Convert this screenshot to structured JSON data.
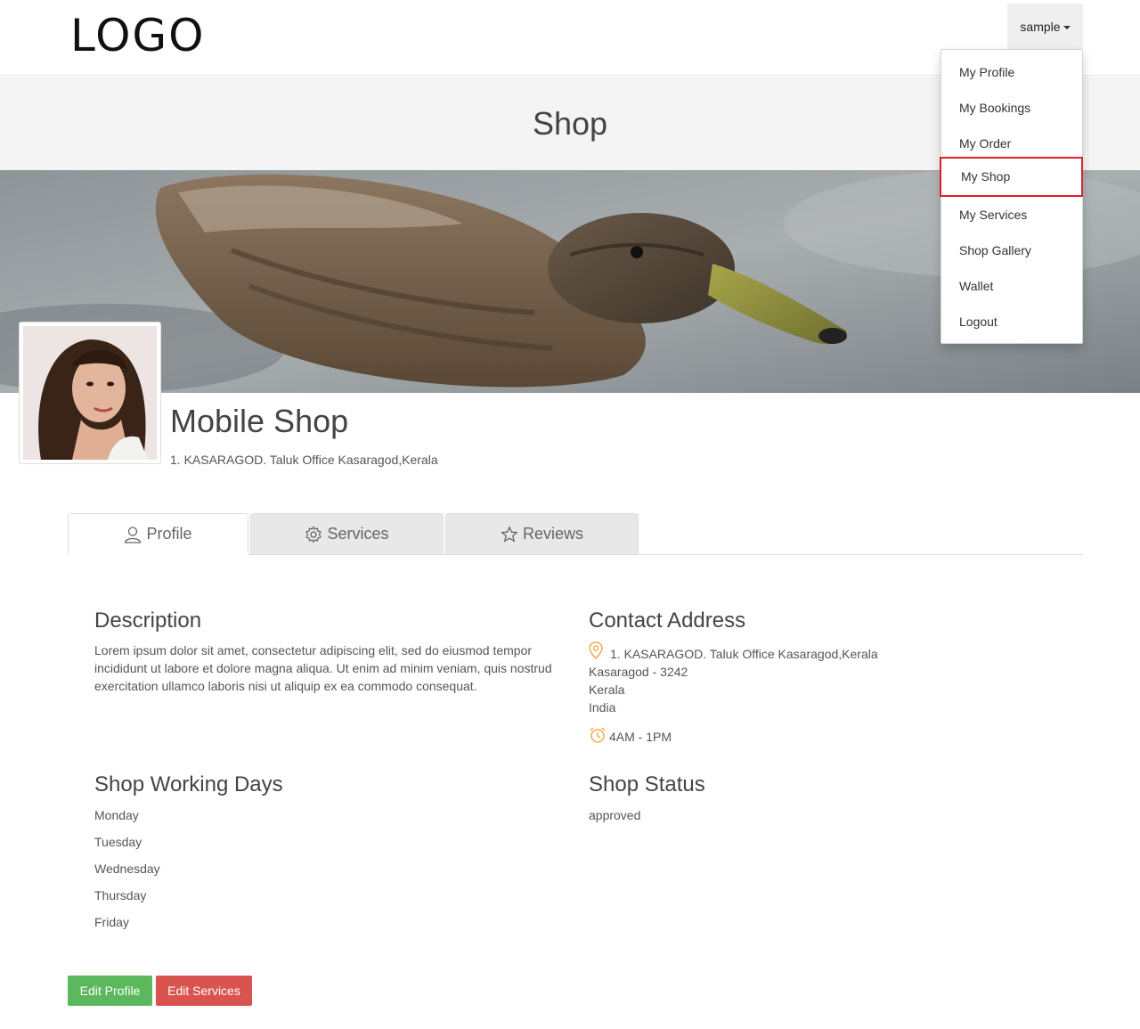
{
  "header": {
    "logo": "LOGO",
    "user_menu_label": "sample"
  },
  "dropdown": {
    "items": [
      "My Profile",
      "My Bookings",
      "My Order",
      "My Shop",
      "My Services",
      "Shop Gallery",
      "Wallet",
      "Logout"
    ],
    "highlighted": "My Shop",
    "highlight_color": "#d9232d"
  },
  "page": {
    "title": "Shop"
  },
  "shop": {
    "name": "Mobile Shop",
    "address": "1. KASARAGOD. Taluk Office Kasaragod,Kerala"
  },
  "tabs": [
    {
      "label": "Profile",
      "icon": "user-icon",
      "active": true
    },
    {
      "label": "Services",
      "icon": "gear-icon",
      "active": false
    },
    {
      "label": "Reviews",
      "icon": "star-icon",
      "active": false
    }
  ],
  "description": {
    "heading": "Description",
    "text": "Lorem ipsum dolor sit amet, consectetur adipiscing elit, sed do eiusmod tempor incididunt ut labore et dolore magna aliqua. Ut enim ad minim veniam, quis nostrud exercitation ullamco laboris nisi ut aliquip ex ea commodo consequat."
  },
  "contact": {
    "heading": "Contact Address",
    "line1": "1. KASARAGOD. Taluk Office Kasaragod,Kerala",
    "line2": "Kasaragod - 3242",
    "line3": "Kerala",
    "line4": "India",
    "hours": "4AM - 1PM",
    "icon_color": "#f0a030"
  },
  "working_days": {
    "heading": "Shop Working Days",
    "days": [
      "Monday",
      "Tuesday",
      "Wednesday",
      "Thursday",
      "Friday"
    ]
  },
  "status": {
    "heading": "Shop Status",
    "value": "approved"
  },
  "buttons": {
    "edit_profile": "Edit Profile",
    "edit_services": "Edit Services"
  }
}
